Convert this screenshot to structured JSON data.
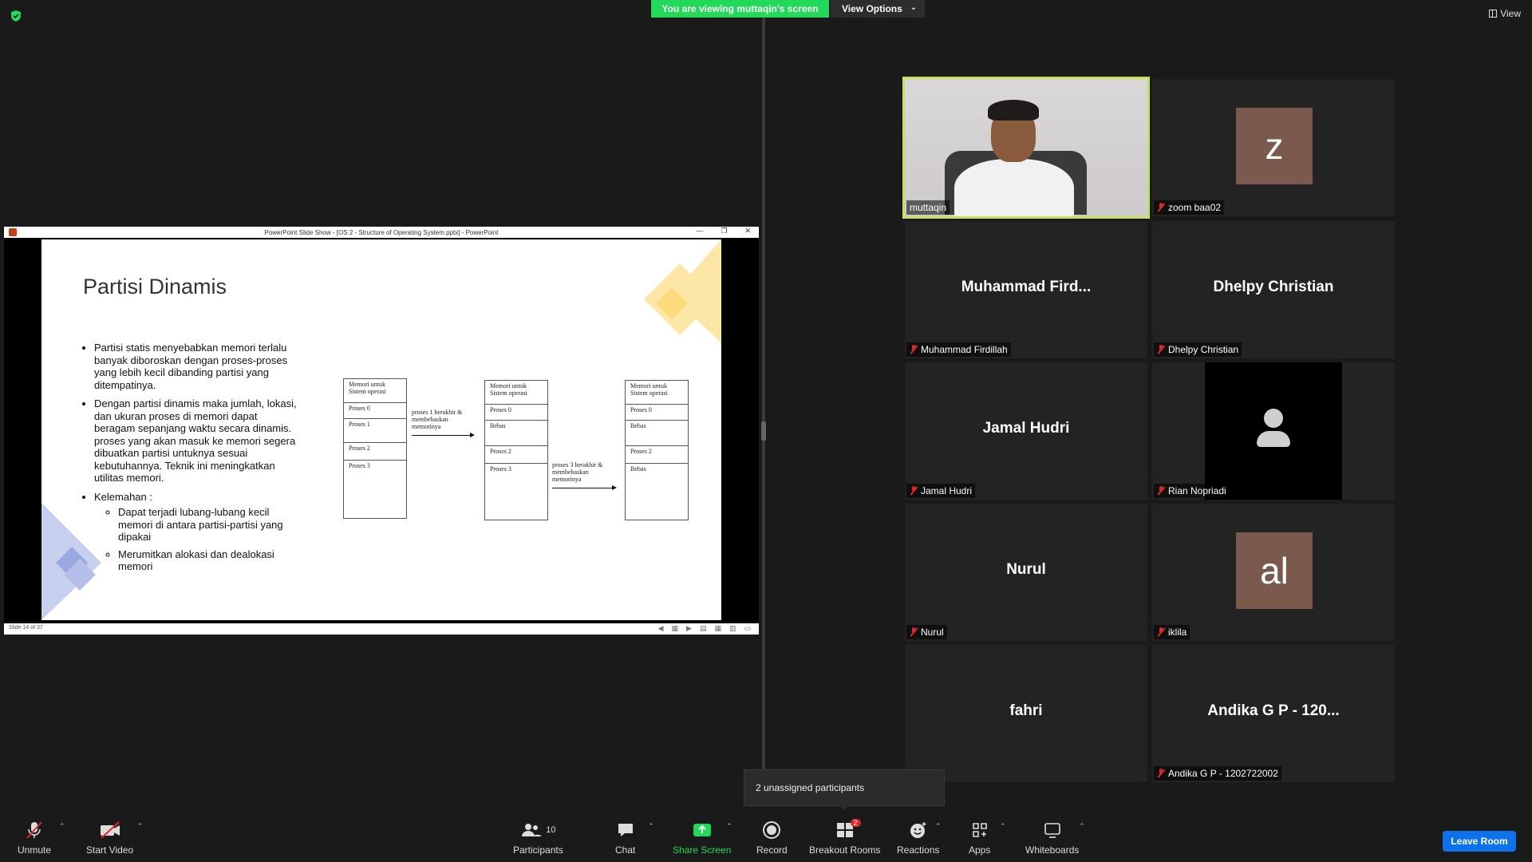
{
  "top_bar": {
    "viewing_banner": "You are viewing muttaqin's screen",
    "view_options_label": "View Options",
    "view_label": "View",
    "banner_color": "#23d959"
  },
  "ppt_window": {
    "title": "PowerPoint Slide Show - [OS 2 - Structure of Operating System.pptx] - PowerPoint",
    "status": "Slide 14 of 37",
    "slide": {
      "title": "Partisi Dinamis",
      "bullets": [
        "Partisi statis menyebabkan memori terlalu banyak diboroskan dengan proses-proses yang lebih kecil dibanding partisi yang ditempatinya.",
        "Dengan partisi dinamis maka jumlah, lokasi, dan ukuran proses di memori dapat beragam sepanjang waktu secara dinamis. proses yang akan masuk ke memori segera dibuatkan partisi untuknya sesuai kebutuhannya. Teknik ini meningkatkan utilitas memori.",
        "Kelemahan :"
      ],
      "sub_bullets": [
        "Dapat terjadi lubang-lubang kecil memori di antara partisi-partisi yang dipakai",
        "Merumitkan alokasi dan dealokasi memori"
      ],
      "diagram": {
        "block1": [
          "Memori untuk Sistem operasi",
          "Proses 0",
          "Proses 1",
          "Proses 2",
          "Proses 3"
        ],
        "block2": [
          "Memori untuk Sistem operasi",
          "Proses 0",
          "Bebas",
          "Proses 2",
          "Proses 3"
        ],
        "block3": [
          "Memori untuk Sistem operasi",
          "Proses 0",
          "Bebas",
          "Proses 2",
          "Bebas"
        ],
        "arrow1": "proses 1 berakhir & membebaskan memorinya",
        "arrow2": "proses 3 berakhir & membebaskan memorinya"
      }
    }
  },
  "gallery": [
    {
      "display": "",
      "label": "muttaqin",
      "muted": false,
      "type": "video"
    },
    {
      "display": "z",
      "label": "zoom baa02",
      "muted": true,
      "type": "avatar"
    },
    {
      "display": "Muhammad  Fird...",
      "label": "Muhammad Firdillah",
      "muted": true,
      "type": "name"
    },
    {
      "display": "Dhelpy Christian",
      "label": "Dhelpy Christian",
      "muted": true,
      "type": "name"
    },
    {
      "display": "Jamal Hudri",
      "label": "Jamal Hudri",
      "muted": true,
      "type": "name"
    },
    {
      "display": "",
      "label": "Rian Nopriadi",
      "muted": true,
      "type": "silhouette"
    },
    {
      "display": "Nurul",
      "label": "Nurul",
      "muted": true,
      "type": "name"
    },
    {
      "display": "al",
      "label": "iklila",
      "muted": true,
      "type": "avatar"
    },
    {
      "display": "fahri",
      "label": "",
      "muted": true,
      "type": "name"
    },
    {
      "display": "Andika G P - 120...",
      "label": "Andika G P - 1202722002",
      "muted": true,
      "type": "name"
    }
  ],
  "tooltip": "2 unassigned participants",
  "toolbar": {
    "unmute": "Unmute",
    "start_video": "Start Video",
    "participants": "Participants",
    "participants_count": "10",
    "chat": "Chat",
    "share_screen": "Share Screen",
    "record": "Record",
    "breakout_rooms": "Breakout Rooms",
    "breakout_badge": "2",
    "reactions": "Reactions",
    "apps": "Apps",
    "whiteboards": "Whiteboards",
    "leave": "Leave Room",
    "share_color": "#23d959",
    "leave_color": "#0e72ed"
  }
}
